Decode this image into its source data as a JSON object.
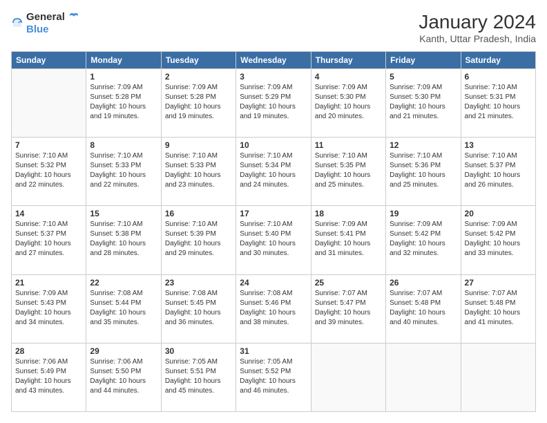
{
  "header": {
    "logo": {
      "general": "General",
      "blue": "Blue"
    },
    "title": "January 2024",
    "location": "Kanth, Uttar Pradesh, India"
  },
  "weekdays": [
    "Sunday",
    "Monday",
    "Tuesday",
    "Wednesday",
    "Thursday",
    "Friday",
    "Saturday"
  ],
  "weeks": [
    [
      {
        "day": "",
        "sunrise": "",
        "sunset": "",
        "daylight": ""
      },
      {
        "day": "1",
        "sunrise": "7:09 AM",
        "sunset": "5:28 PM",
        "daylight": "10 hours and 19 minutes."
      },
      {
        "day": "2",
        "sunrise": "7:09 AM",
        "sunset": "5:28 PM",
        "daylight": "10 hours and 19 minutes."
      },
      {
        "day": "3",
        "sunrise": "7:09 AM",
        "sunset": "5:29 PM",
        "daylight": "10 hours and 19 minutes."
      },
      {
        "day": "4",
        "sunrise": "7:09 AM",
        "sunset": "5:30 PM",
        "daylight": "10 hours and 20 minutes."
      },
      {
        "day": "5",
        "sunrise": "7:09 AM",
        "sunset": "5:30 PM",
        "daylight": "10 hours and 21 minutes."
      },
      {
        "day": "6",
        "sunrise": "7:10 AM",
        "sunset": "5:31 PM",
        "daylight": "10 hours and 21 minutes."
      }
    ],
    [
      {
        "day": "7",
        "sunrise": "7:10 AM",
        "sunset": "5:32 PM",
        "daylight": "10 hours and 22 minutes."
      },
      {
        "day": "8",
        "sunrise": "7:10 AM",
        "sunset": "5:33 PM",
        "daylight": "10 hours and 22 minutes."
      },
      {
        "day": "9",
        "sunrise": "7:10 AM",
        "sunset": "5:33 PM",
        "daylight": "10 hours and 23 minutes."
      },
      {
        "day": "10",
        "sunrise": "7:10 AM",
        "sunset": "5:34 PM",
        "daylight": "10 hours and 24 minutes."
      },
      {
        "day": "11",
        "sunrise": "7:10 AM",
        "sunset": "5:35 PM",
        "daylight": "10 hours and 25 minutes."
      },
      {
        "day": "12",
        "sunrise": "7:10 AM",
        "sunset": "5:36 PM",
        "daylight": "10 hours and 25 minutes."
      },
      {
        "day": "13",
        "sunrise": "7:10 AM",
        "sunset": "5:37 PM",
        "daylight": "10 hours and 26 minutes."
      }
    ],
    [
      {
        "day": "14",
        "sunrise": "7:10 AM",
        "sunset": "5:37 PM",
        "daylight": "10 hours and 27 minutes."
      },
      {
        "day": "15",
        "sunrise": "7:10 AM",
        "sunset": "5:38 PM",
        "daylight": "10 hours and 28 minutes."
      },
      {
        "day": "16",
        "sunrise": "7:10 AM",
        "sunset": "5:39 PM",
        "daylight": "10 hours and 29 minutes."
      },
      {
        "day": "17",
        "sunrise": "7:10 AM",
        "sunset": "5:40 PM",
        "daylight": "10 hours and 30 minutes."
      },
      {
        "day": "18",
        "sunrise": "7:09 AM",
        "sunset": "5:41 PM",
        "daylight": "10 hours and 31 minutes."
      },
      {
        "day": "19",
        "sunrise": "7:09 AM",
        "sunset": "5:42 PM",
        "daylight": "10 hours and 32 minutes."
      },
      {
        "day": "20",
        "sunrise": "7:09 AM",
        "sunset": "5:42 PM",
        "daylight": "10 hours and 33 minutes."
      }
    ],
    [
      {
        "day": "21",
        "sunrise": "7:09 AM",
        "sunset": "5:43 PM",
        "daylight": "10 hours and 34 minutes."
      },
      {
        "day": "22",
        "sunrise": "7:08 AM",
        "sunset": "5:44 PM",
        "daylight": "10 hours and 35 minutes."
      },
      {
        "day": "23",
        "sunrise": "7:08 AM",
        "sunset": "5:45 PM",
        "daylight": "10 hours and 36 minutes."
      },
      {
        "day": "24",
        "sunrise": "7:08 AM",
        "sunset": "5:46 PM",
        "daylight": "10 hours and 38 minutes."
      },
      {
        "day": "25",
        "sunrise": "7:07 AM",
        "sunset": "5:47 PM",
        "daylight": "10 hours and 39 minutes."
      },
      {
        "day": "26",
        "sunrise": "7:07 AM",
        "sunset": "5:48 PM",
        "daylight": "10 hours and 40 minutes."
      },
      {
        "day": "27",
        "sunrise": "7:07 AM",
        "sunset": "5:48 PM",
        "daylight": "10 hours and 41 minutes."
      }
    ],
    [
      {
        "day": "28",
        "sunrise": "7:06 AM",
        "sunset": "5:49 PM",
        "daylight": "10 hours and 43 minutes."
      },
      {
        "day": "29",
        "sunrise": "7:06 AM",
        "sunset": "5:50 PM",
        "daylight": "10 hours and 44 minutes."
      },
      {
        "day": "30",
        "sunrise": "7:05 AM",
        "sunset": "5:51 PM",
        "daylight": "10 hours and 45 minutes."
      },
      {
        "day": "31",
        "sunrise": "7:05 AM",
        "sunset": "5:52 PM",
        "daylight": "10 hours and 46 minutes."
      },
      {
        "day": "",
        "sunrise": "",
        "sunset": "",
        "daylight": ""
      },
      {
        "day": "",
        "sunrise": "",
        "sunset": "",
        "daylight": ""
      },
      {
        "day": "",
        "sunrise": "",
        "sunset": "",
        "daylight": ""
      }
    ]
  ]
}
